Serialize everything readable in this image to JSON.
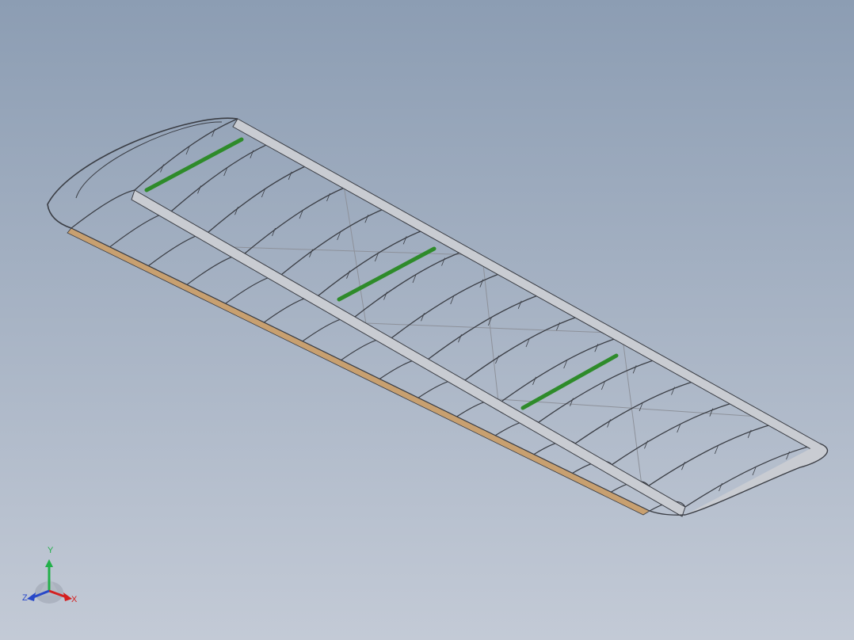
{
  "viewport": {
    "background_top": "#8c9db3",
    "background_bottom": "#c3cad6"
  },
  "model": {
    "frame_color": "#3a3d44",
    "spar_fill": "#c9ccd2",
    "tube_color": "#2e8b2a",
    "trailing_strip_color": "#c8a070",
    "brace_wire_color": "#8d919a"
  },
  "triad": {
    "x_label": "X",
    "y_label": "Y",
    "z_label": "Z",
    "x_color": "#d42020",
    "y_color": "#22b04a",
    "z_color": "#2848c8"
  }
}
